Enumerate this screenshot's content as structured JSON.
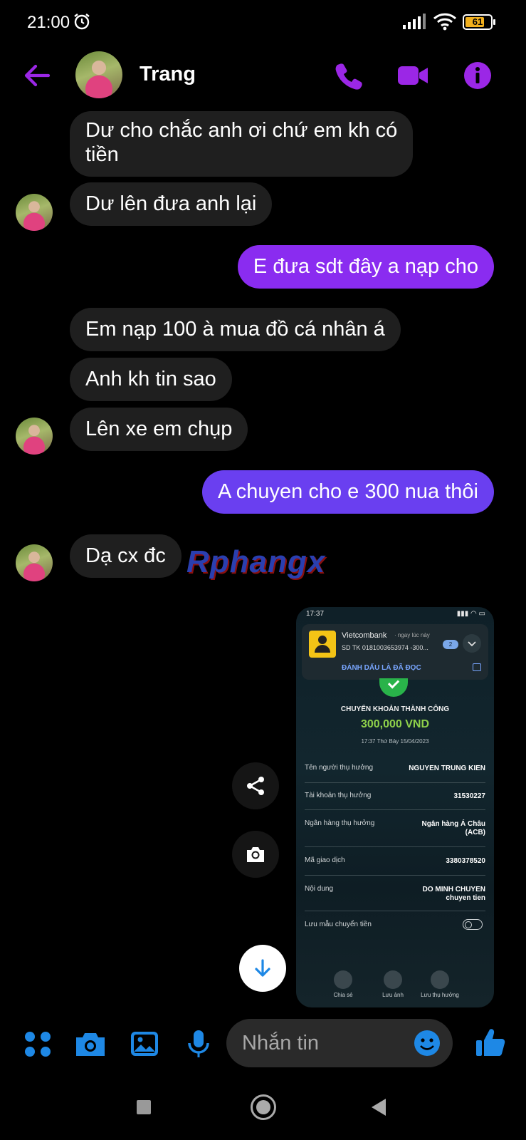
{
  "status_bar": {
    "time": "21:00",
    "battery": "61"
  },
  "header": {
    "contact_name": "Trang"
  },
  "messages": [
    {
      "from": "them",
      "text": "Dư cho chắc anh ơi chứ em kh có\ntiền"
    },
    {
      "from": "them",
      "text": "Dư lên đưa anh lại"
    },
    {
      "from": "me",
      "text": "E đưa sdt đây a nạp cho"
    },
    {
      "from": "them",
      "text": "Em nạp 100 à mua đồ cá nhân á"
    },
    {
      "from": "them",
      "text": "Anh kh tin sao"
    },
    {
      "from": "them",
      "text": "Lên xe em chụp"
    },
    {
      "from": "me",
      "text": "A chuyen cho e 300 nua thôi"
    },
    {
      "from": "them",
      "text": "Dạ cx đc"
    }
  ],
  "watermark": "Rphangx",
  "transfer_screenshot": {
    "status_time": "17:37",
    "notification": {
      "bank": "Vietcombank",
      "when": "· ngay lúc này",
      "account_line": "SD TK 0181003653974 -300...",
      "badge": "2",
      "mark_read": "ĐÁNH DẤU LÀ ĐÃ ĐỌC"
    },
    "title": "CHUYỂN KHOẢN THÀNH CÔNG",
    "amount": "300,000 VND",
    "datetime": "17:37 Thứ Bảy 15/04/2023",
    "details": [
      {
        "label": "Tên người thụ hưởng",
        "value": "NGUYEN TRUNG KIEN",
        "value2": ""
      },
      {
        "label": "Tài khoản thụ hưởng",
        "value": "31530227",
        "value2": ""
      },
      {
        "label": "Ngân hàng thụ hưởng",
        "value": "Ngân hàng Á Châu",
        "value2": "(ACB)"
      },
      {
        "label": "Mã giao dịch",
        "value": "3380378520",
        "value2": ""
      },
      {
        "label": "Nội dung",
        "value": "DO MINH CHUYEN",
        "value2": "chuyen tien"
      }
    ],
    "save_template_label": "Lưu mẫu chuyển tiền",
    "actions": [
      "Chia sẻ",
      "Lưu ảnh",
      "Lưu thụ hưởng"
    ]
  },
  "composer": {
    "placeholder": "Nhắn tin"
  },
  "colors": {
    "accent": "#9b27e6",
    "messenger_blue": "#1e88e5",
    "outgoing_bubble": "#8a2cf0"
  }
}
